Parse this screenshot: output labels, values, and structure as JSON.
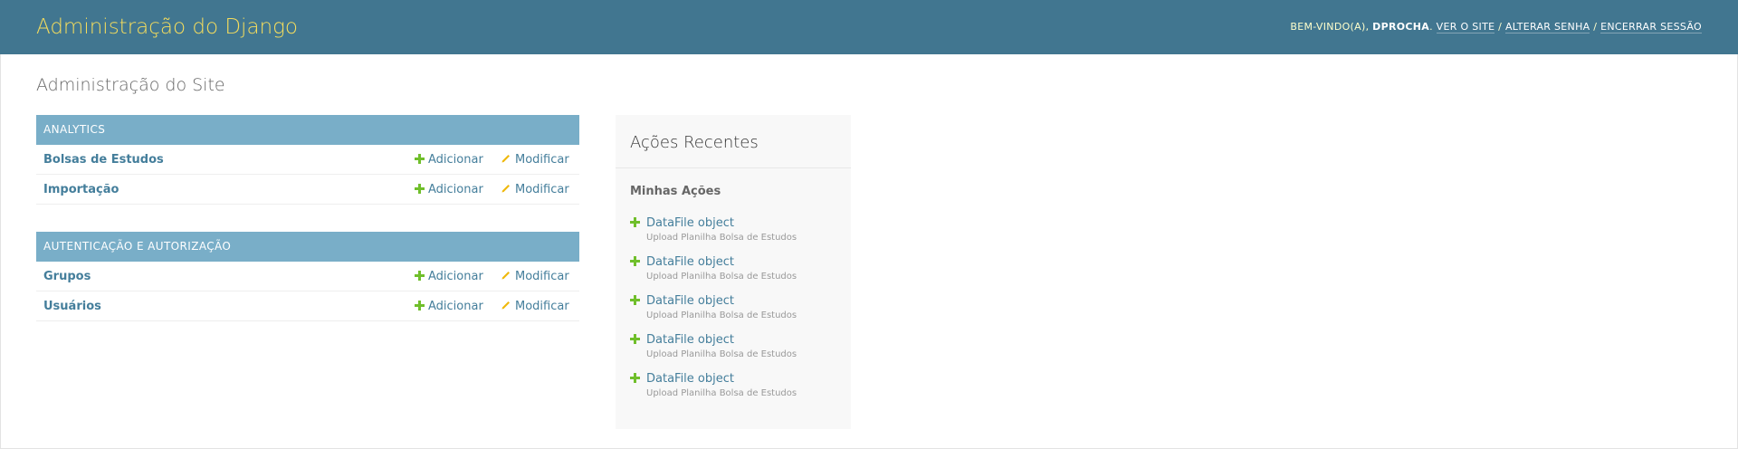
{
  "header": {
    "branding": "Administração do Django",
    "welcome_prefix": "BEM-VINDO(A),",
    "username": "DPROCHA",
    "view_site": "VER O SITE",
    "change_password": "ALTERAR SENHA",
    "logout": "ENCERRAR SESSÃO",
    "separator": "/"
  },
  "page_title": "Administração do Site",
  "modules": [
    {
      "caption": "ANALYTICS",
      "rows": [
        {
          "name": "Bolsas de Estudos",
          "add": "Adicionar",
          "change": "Modificar"
        },
        {
          "name": "Importação",
          "add": "Adicionar",
          "change": "Modificar"
        }
      ]
    },
    {
      "caption": "AUTENTICAÇÃO E AUTORIZAÇÃO",
      "rows": [
        {
          "name": "Grupos",
          "add": "Adicionar",
          "change": "Modificar"
        },
        {
          "name": "Usuários",
          "add": "Adicionar",
          "change": "Modificar"
        }
      ]
    }
  ],
  "recent_actions": {
    "title": "Ações Recentes",
    "subtitle": "Minhas Ações",
    "items": [
      {
        "object": "DataFile object",
        "type": "Upload Planilha Bolsa de Estudos"
      },
      {
        "object": "DataFile object",
        "type": "Upload Planilha Bolsa de Estudos"
      },
      {
        "object": "DataFile object",
        "type": "Upload Planilha Bolsa de Estudos"
      },
      {
        "object": "DataFile object",
        "type": "Upload Planilha Bolsa de Estudos"
      },
      {
        "object": "DataFile object",
        "type": "Upload Planilha Bolsa de Estudos"
      }
    ]
  },
  "icons": {
    "add": "plus-icon",
    "change": "pencil-icon"
  },
  "colors": {
    "header_bg": "#417690",
    "branding": "#f5dd5d",
    "module_caption_bg": "#79aec8",
    "link": "#447e9b",
    "add_icon": "#70bf2b",
    "change_icon": "#efb80b"
  }
}
